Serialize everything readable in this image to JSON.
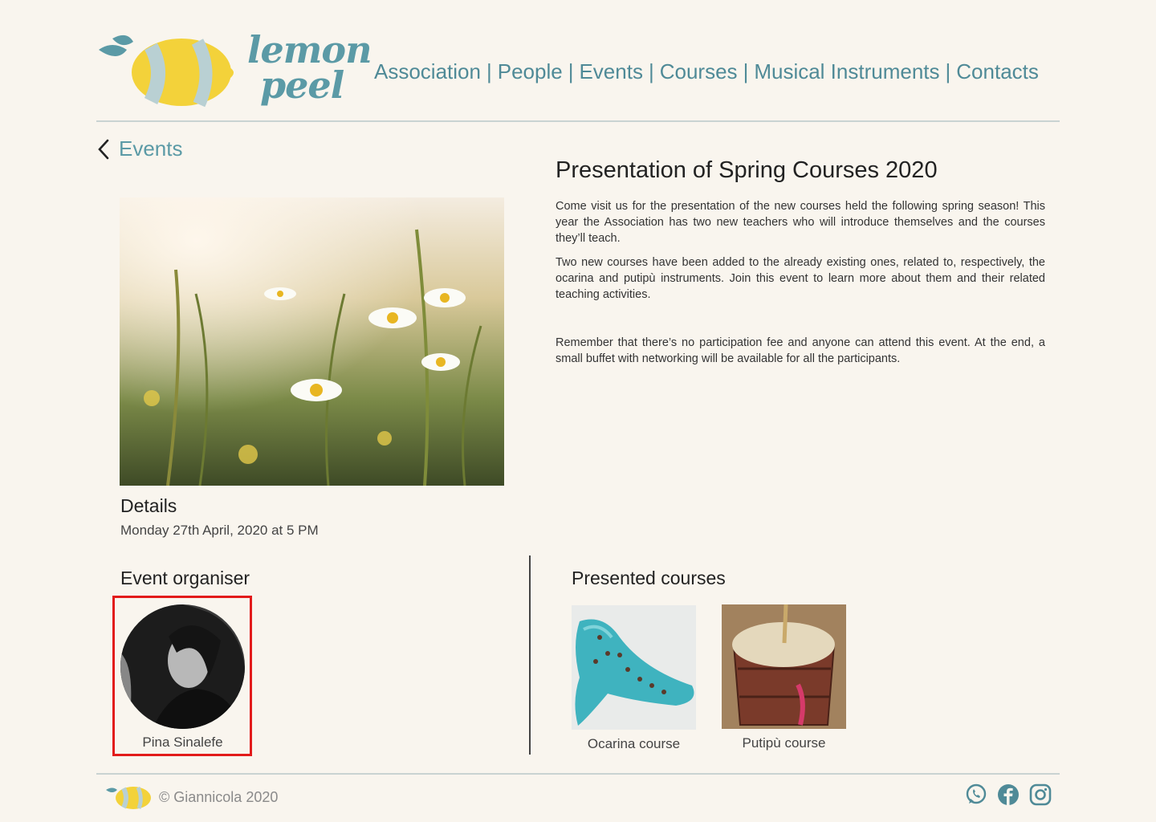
{
  "header": {
    "logo_line1": "lemon",
    "logo_line2": "peel",
    "nav": [
      "Association",
      "People",
      "Events",
      "Courses",
      "Musical Instruments",
      "Contacts"
    ],
    "separator": "|"
  },
  "back_link": {
    "label": "Events"
  },
  "event": {
    "title": "Presentation of Spring Courses 2020",
    "paragraphs": [
      "Come visit us for the presentation of the new courses held the following spring season! This year the Association has two new teachers who will introduce themselves and the courses they’ll teach.",
      "Two new courses have been added to the already existing ones, related to, respectively, the ocarina and putipù instruments. Join this event to learn more about them and their related teaching activities.",
      "Remember that there’s no participation fee and anyone can attend this event. At the end, a small buffet with networking will be available for all the participants."
    ]
  },
  "details": {
    "title": "Details",
    "date": "Monday 27th April, 2020 at 5 PM"
  },
  "organiser": {
    "title": "Event organiser",
    "name": "Pina Sinalefe"
  },
  "courses": {
    "title": "Presented courses",
    "items": [
      {
        "label": "Ocarina course"
      },
      {
        "label": "Putipù course"
      }
    ]
  },
  "footer": {
    "copyright": "© Giannicola 2020",
    "social_icons": [
      "whatsapp-icon",
      "facebook-icon",
      "instagram-icon"
    ]
  },
  "colors": {
    "background": "#f9f5ee",
    "accent": "#4f8a97",
    "highlight_box": "#e21b1b",
    "lemon": "#f3d23a"
  }
}
